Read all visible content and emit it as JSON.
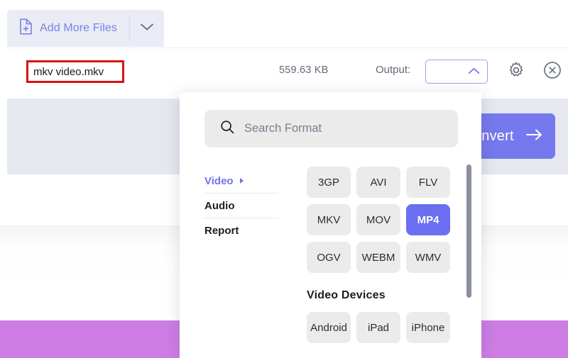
{
  "toolbar": {
    "add_more_files_label": "Add More Files",
    "add_icon": "file-plus-icon",
    "caret_icon": "chevron-down-icon"
  },
  "file_row": {
    "file_name": "mkv video.mkv",
    "file_size": "559.63 KB",
    "output_label": "Output:",
    "output_value": "",
    "output_caret_icon": "chevron-up-icon",
    "settings_icon": "gear-icon",
    "remove_icon": "close-circle-icon",
    "highlight_color": "#dd1111"
  },
  "convert": {
    "label": "Convert",
    "arrow_icon": "arrow-right-icon",
    "accent_color": "#7678ed"
  },
  "format_panel": {
    "search": {
      "placeholder": "Search Format",
      "value": "",
      "icon": "search-icon"
    },
    "categories": [
      {
        "label": "Video",
        "active": true
      },
      {
        "label": "Audio",
        "active": false
      },
      {
        "label": "Report",
        "active": false
      }
    ],
    "formats": [
      {
        "label": "3GP",
        "selected": false
      },
      {
        "label": "AVI",
        "selected": false
      },
      {
        "label": "FLV",
        "selected": false
      },
      {
        "label": "MKV",
        "selected": false
      },
      {
        "label": "MOV",
        "selected": false
      },
      {
        "label": "MP4",
        "selected": true
      },
      {
        "label": "OGV",
        "selected": false
      },
      {
        "label": "WEBM",
        "selected": false
      },
      {
        "label": "WMV",
        "selected": false
      }
    ],
    "devices_title": "Video Devices",
    "devices": [
      {
        "label": "Android",
        "selected": false
      },
      {
        "label": "iPad",
        "selected": false
      },
      {
        "label": "iPhone",
        "selected": false
      }
    ],
    "selected_color": "#6b6ef0"
  },
  "background": {
    "accent_band_color": "#cd7de4"
  }
}
